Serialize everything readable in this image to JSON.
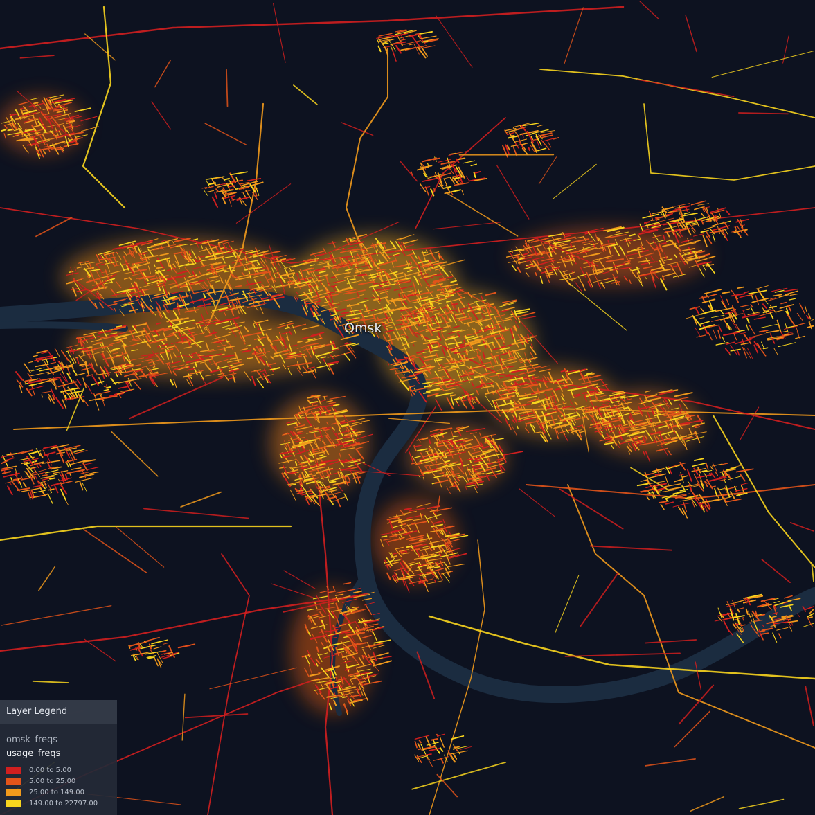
{
  "map": {
    "background_color": "#0d1220",
    "river_color": "#1b2c40",
    "city_label": "Omsk"
  },
  "legend": {
    "title": "Layer Legend",
    "layer_name": "omsk_freqs",
    "field_name": "usage_freqs",
    "items": [
      {
        "label": "0.00 to 5.00",
        "color": "#d11f1f"
      },
      {
        "label": "5.00 to 25.00",
        "color": "#e2541a"
      },
      {
        "label": "25.00 to 149.00",
        "color": "#f19a1c"
      },
      {
        "label": "149.00 to 22797.00",
        "color": "#f8d51e"
      }
    ]
  }
}
